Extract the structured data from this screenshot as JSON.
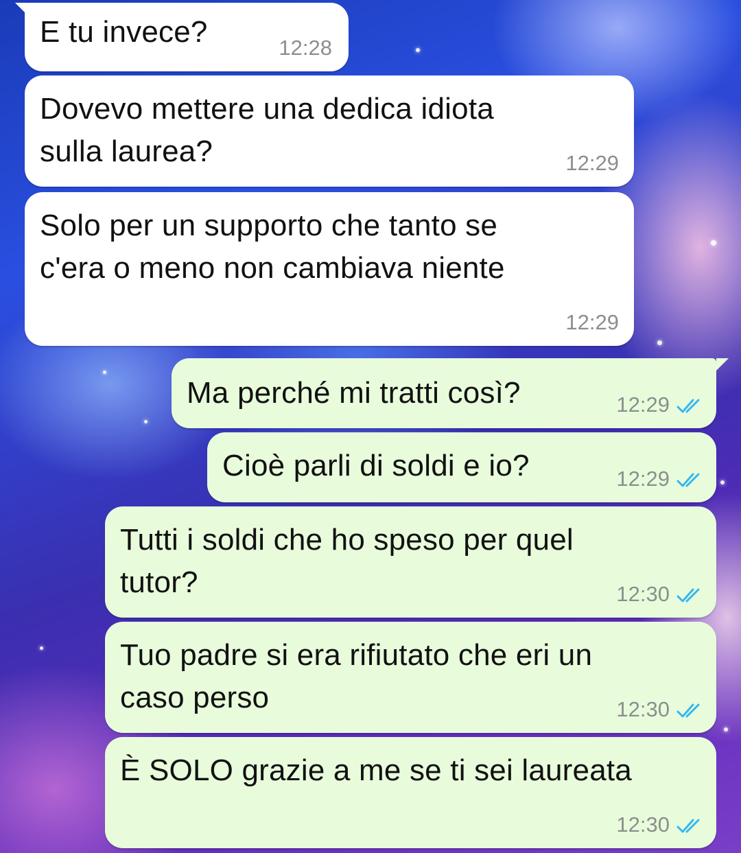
{
  "colors": {
    "incoming_bubble": "#ffffff",
    "outgoing_bubble": "#e8fcdc",
    "text": "#111111",
    "timestamp": "#8a8f8c",
    "read_ticks": "#34b7f1"
  },
  "messages": [
    {
      "direction": "incoming",
      "text": "E tu invece?",
      "time": "12:28"
    },
    {
      "direction": "incoming",
      "text": "Dovevo mettere una dedica idiota\nsulla laurea?",
      "time": "12:29"
    },
    {
      "direction": "incoming",
      "text": "Solo per un supporto che tanto se\nc'era o meno non cambiava niente",
      "time": "12:29"
    },
    {
      "direction": "outgoing",
      "text": "Ma perché mi tratti così?",
      "time": "12:29",
      "status_icon": "double-check-read-icon"
    },
    {
      "direction": "outgoing",
      "text": "Cioè parli di soldi e io?",
      "time": "12:29",
      "status_icon": "double-check-read-icon"
    },
    {
      "direction": "outgoing",
      "text": "Tutti i soldi che ho speso per quel\ntutor?",
      "time": "12:30",
      "status_icon": "double-check-read-icon"
    },
    {
      "direction": "outgoing",
      "text": "Tuo padre si era rifiutato che eri un\ncaso perso",
      "time": "12:30",
      "status_icon": "double-check-read-icon"
    },
    {
      "direction": "outgoing",
      "text": "È SOLO grazie a me se ti sei laureata",
      "time": "12:30",
      "status_icon": "double-check-read-icon"
    }
  ]
}
